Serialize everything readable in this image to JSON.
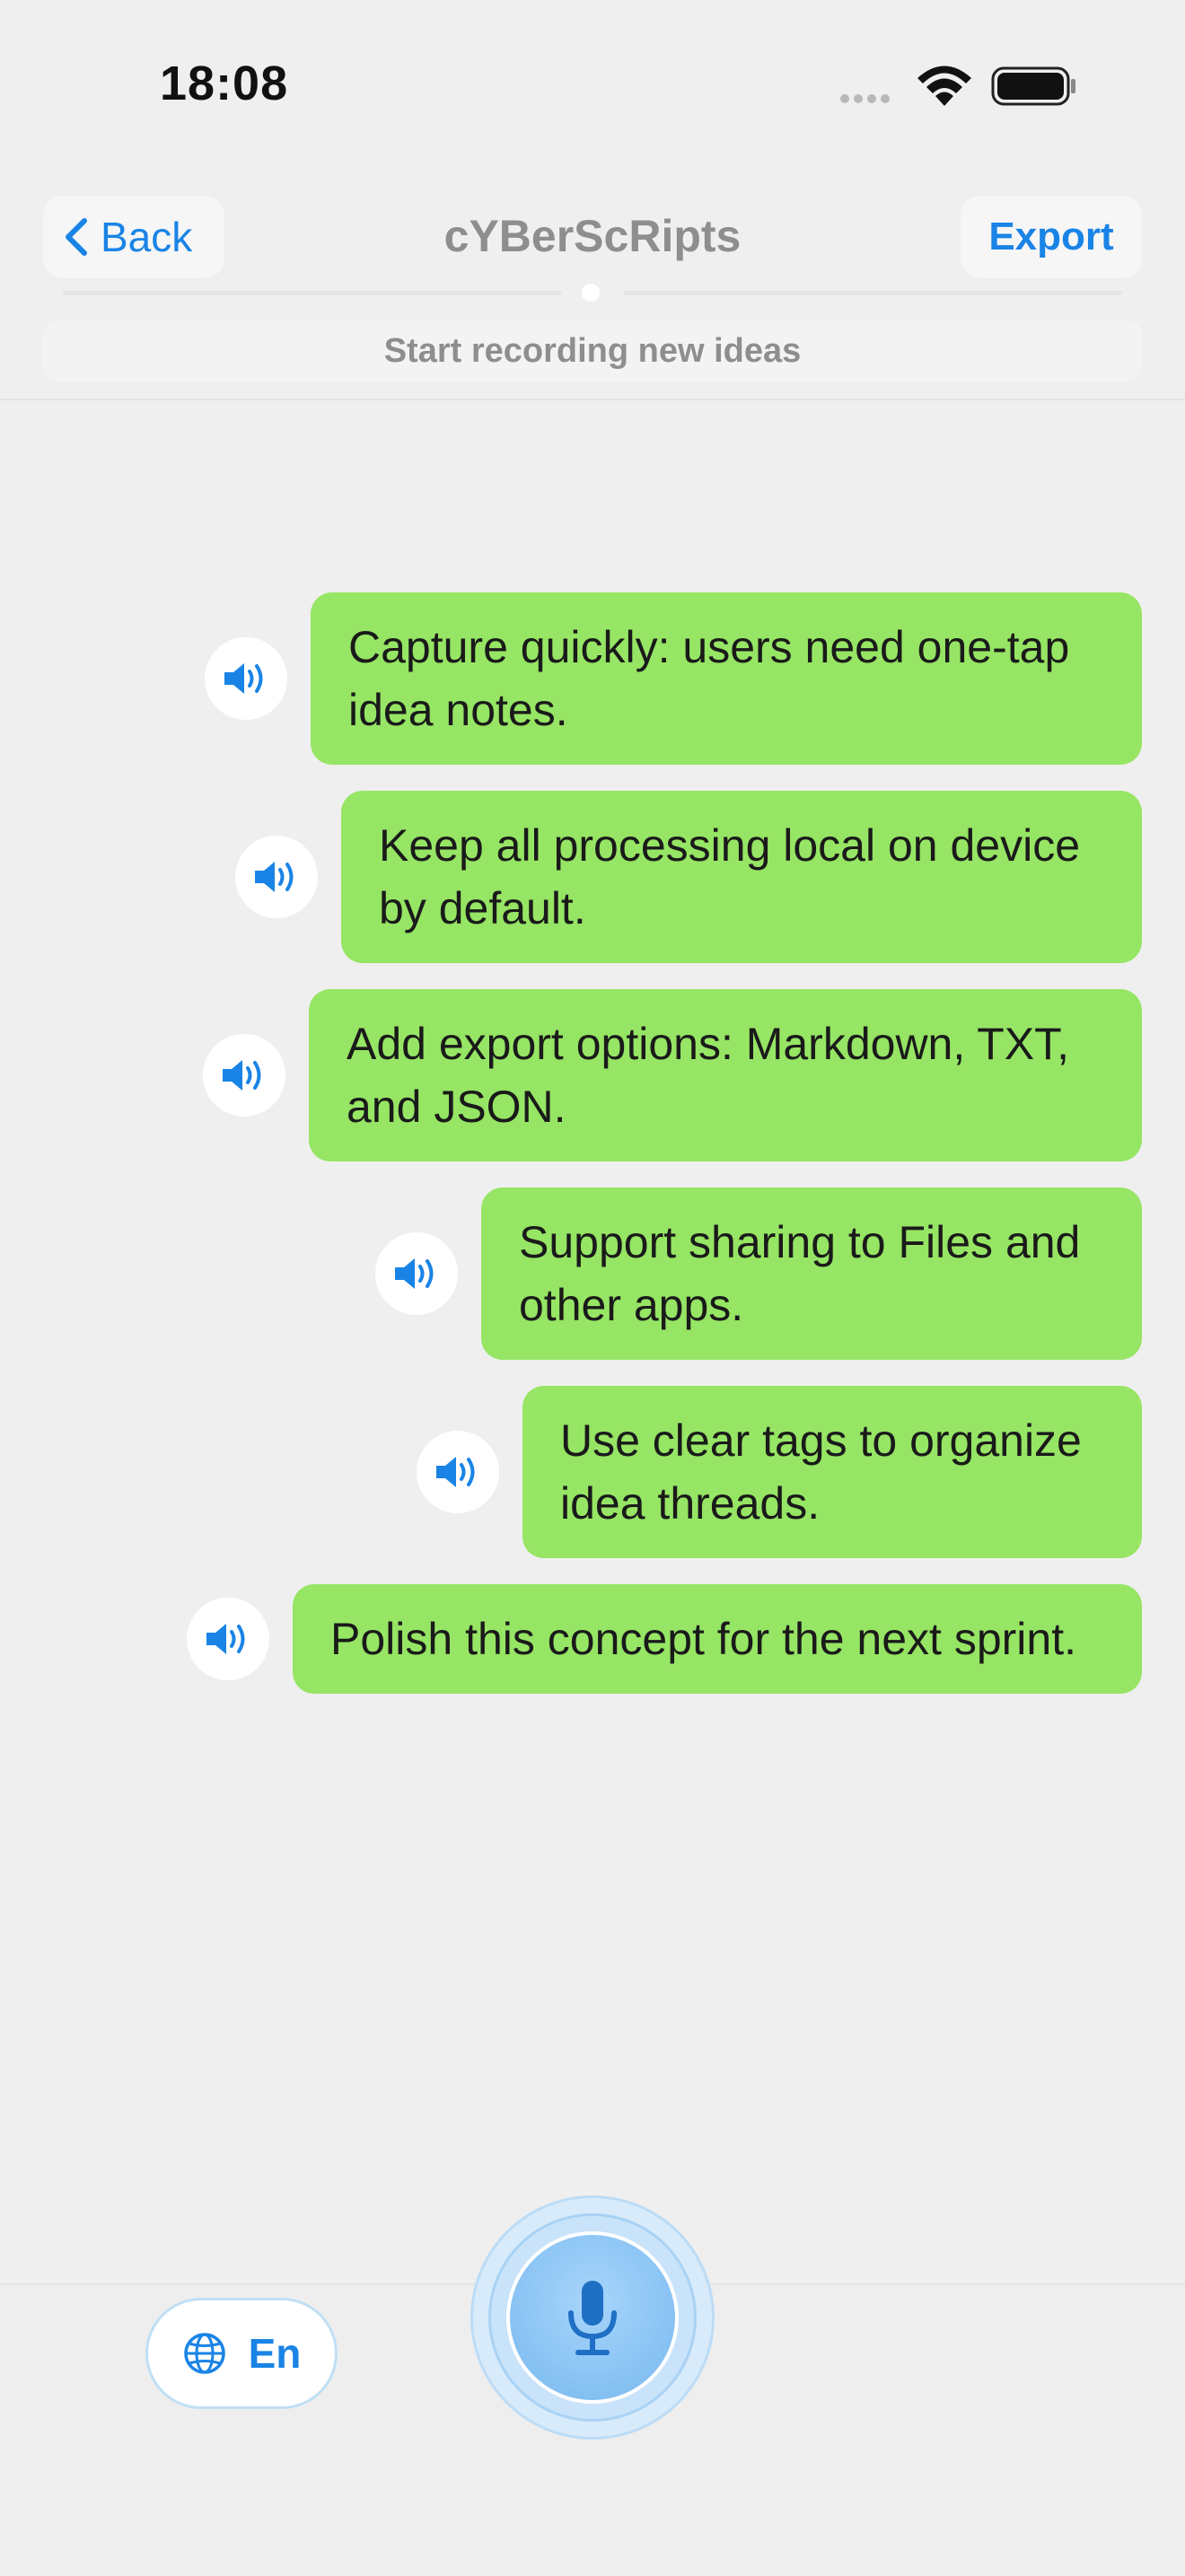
{
  "status_bar": {
    "time": "18:08"
  },
  "nav": {
    "back_label": "Back",
    "title": "cYBerScRipts",
    "export_label": "Export",
    "hint": "Start recording new ideas"
  },
  "messages": [
    {
      "text": "Capture quickly: users need one-tap idea notes."
    },
    {
      "text": "Keep all processing local on device by default."
    },
    {
      "text": "Add export options: Markdown, TXT, and JSON."
    },
    {
      "text": "Support sharing to Files and other apps."
    },
    {
      "text": "Use clear tags to organize idea threads."
    },
    {
      "text": "Polish this concept for the next sprint."
    }
  ],
  "bottom": {
    "language_label": "En"
  },
  "colors": {
    "accent": "#1a84e6",
    "bubble": "#96e564",
    "background": "#efefef"
  },
  "icons": {
    "back": "chevron-left-icon",
    "speaker": "speaker-icon",
    "language": "globe-icon",
    "mic": "microphone-icon"
  }
}
